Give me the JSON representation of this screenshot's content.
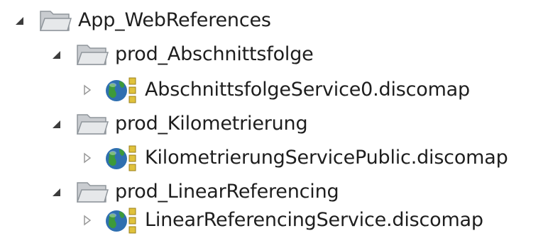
{
  "tree": {
    "root": {
      "label": "App_WebReferences",
      "expanded": true,
      "icon": "folder-icon"
    },
    "folders": [
      {
        "label": "prod_Abschnittsfolge",
        "expanded": true,
        "icon": "folder-icon",
        "child": {
          "label": "AbschnittsfolgeService0.discomap",
          "expanded": false,
          "icon": "web-reference-icon"
        }
      },
      {
        "label": "prod_Kilometrierung",
        "expanded": true,
        "icon": "folder-icon",
        "child": {
          "label": "KilometrierungServicePublic.discomap",
          "expanded": false,
          "icon": "web-reference-icon"
        }
      },
      {
        "label": "prod_LinearReferencing",
        "expanded": true,
        "icon": "folder-icon",
        "child": {
          "label": "LinearReferencingService.discomap",
          "expanded": false,
          "icon": "web-reference-icon"
        }
      }
    ]
  },
  "colors": {
    "text": "#1e1e1e",
    "expanded_arrow": "#3c3c3c",
    "collapsed_arrow": "#9a9a9a",
    "folder_back": "#c9ccd0",
    "folder_front": "#e6e8ea",
    "folder_edge": "#8f959b",
    "globe_blue": "#2f6fb0",
    "globe_green": "#3d9a3a",
    "reference_yellow": "#e0c23c"
  }
}
